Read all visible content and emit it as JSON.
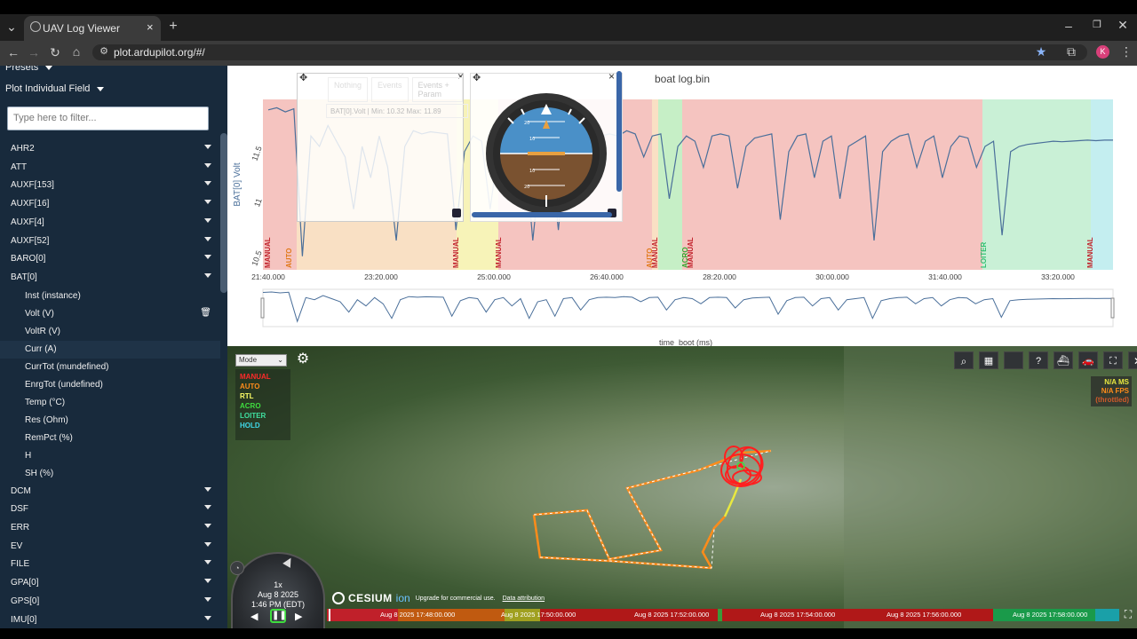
{
  "browser": {
    "tab_title": "UAV Log Viewer",
    "url": "plot.ardupilot.org/#/",
    "profile_initial": "K"
  },
  "sidebar": {
    "presets_label": "Presets",
    "plot_field_label": "Plot Individual Field",
    "filter_placeholder": "Type here to filter...",
    "fields": [
      "AHR2",
      "ATT",
      "AUXF[153]",
      "AUXF[16]",
      "AUXF[4]",
      "AUXF[52]",
      "BARO[0]",
      "BAT[0]"
    ],
    "bat_subfields": [
      "Inst (instance)",
      "Volt (V)",
      "VoltR (V)",
      "Curr (A)",
      "CurrTot (mundefined)",
      "EnrgTot (undefined)",
      "Temp (°C)",
      "Res (Ohm)",
      "RemPct (%)",
      "H",
      "SH (%)"
    ],
    "fields_after": [
      "DCM",
      "DSF",
      "ERR",
      "EV",
      "FILE",
      "GPA[0]",
      "GPS[0]",
      "IMU[0]"
    ]
  },
  "plot": {
    "title": "boat log.bin",
    "ylabel": "BAT[0] Volt",
    "xlabel": "time_boot (ms)",
    "overlay_buttons": [
      "Nothing",
      "Events",
      "Events + Param"
    ],
    "legend_text": "BAT[0].Volt | Min: 10.32     Max: 11.89",
    "close_glyph": "×",
    "mode_labels": [
      "MANUAL",
      "AUTO",
      "MANUAL",
      "MANUAL",
      "MANUAL",
      "AUTO",
      "ACRO",
      "MANUAL",
      "LOITER",
      "MANUAL"
    ],
    "colors": {
      "line": "#4a6f9a",
      "manual": "#f5c4c0",
      "auto": "#f9e0c4",
      "rtl": "#f7f3b8",
      "acro": "#c6efc6",
      "loiter": "#c9f0d6",
      "hold": "#c4eef0"
    }
  },
  "chart_data": {
    "type": "line",
    "title": "boat log.bin",
    "xlabel": "time_boot (ms)",
    "ylabel": "BAT[0] Volt",
    "x_ticks": [
      "21:40.000",
      "23:20.000",
      "25:00.000",
      "26:40.000",
      "28:20.000",
      "30:00.000",
      "31:40.000",
      "33:20.000"
    ],
    "y_ticks": [
      10.5,
      11,
      11.5
    ],
    "ylim": [
      10.32,
      11.95
    ],
    "series": [
      {
        "name": "BAT[0].Volt",
        "min": 10.32,
        "max": 11.89,
        "values": [
          11.85,
          11.87,
          11.83,
          11.86,
          10.45,
          11.6,
          11.5,
          11.7,
          11.55,
          11.4,
          10.9,
          11.5,
          11.2,
          11.6,
          11.3,
          10.6,
          11.5,
          11.65,
          11.62,
          11.64,
          11.63,
          11.62,
          10.7,
          11.45,
          11.6,
          11.55,
          10.9,
          11.5,
          11.6,
          11.2,
          11.55,
          10.6,
          11.4,
          11.5,
          10.7,
          11.55,
          11.6,
          11.0,
          11.5,
          11.6,
          11.62,
          11.6,
          11.65,
          11.62,
          11.4,
          11.6,
          11.62,
          11.0,
          11.5,
          11.6,
          11.55,
          11.3,
          11.6,
          11.62,
          11.6,
          11.1,
          11.5,
          11.58,
          11.6,
          11.62,
          10.8,
          11.45,
          11.6,
          11.62,
          11.2,
          11.55,
          11.6,
          11.0,
          11.5,
          11.55,
          11.6,
          10.6,
          11.45,
          11.55,
          11.6,
          11.62,
          11.3,
          11.55,
          11.6,
          11.2,
          11.5,
          11.6,
          11.58,
          11.3,
          11.5,
          11.55,
          10.65,
          11.45,
          11.5,
          11.52,
          11.53,
          11.54,
          11.55,
          11.545,
          11.55,
          11.555,
          11.56,
          11.555,
          11.56,
          11.56
        ]
      }
    ]
  },
  "attitude_widget": {
    "close_glyph": "×",
    "ticks": [
      "20",
      "10",
      "10",
      "20"
    ]
  },
  "map": {
    "mode_select": "Mode",
    "legend": [
      {
        "label": "MANUAL",
        "color": "#ff2a2a"
      },
      {
        "label": "AUTO",
        "color": "#ff8c1a"
      },
      {
        "label": "RTL",
        "color": "#ffff66"
      },
      {
        "label": "ACRO",
        "color": "#3fdd3f"
      },
      {
        "label": "LOITER",
        "color": "#3fe0a0"
      },
      {
        "label": "HOLD",
        "color": "#3fd8e8"
      }
    ],
    "stats": {
      "ms": "N/A MS",
      "fps": "N/A FPS",
      "throttled": "(throttled)"
    },
    "cesium_logo": "CESIUM",
    "cesium_ion": "ion",
    "upgrade_text": "Upgrade for commercial use.",
    "attribution": "Data attribution",
    "clock": {
      "speed": "1x",
      "date": "Aug 8 2025",
      "time": "1:46 PM (EDT)"
    },
    "timeline_labels": [
      "Aug 8 2025 17:48:00.000",
      "Aug 8 2025 17:50:00.000",
      "Aug 8 2025 17:52:00.000",
      "Aug 8 2025 17:54:00.000",
      "Aug 8 2025 17:56:00.000",
      "Aug 8 2025 17:58:00.000"
    ]
  }
}
